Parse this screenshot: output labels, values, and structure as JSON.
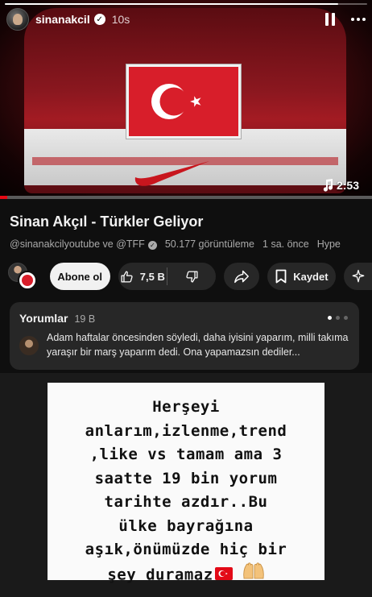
{
  "story": {
    "username": "sinanakcil",
    "time": "10s",
    "progress": 0.92
  },
  "video": {
    "duration": "2:53",
    "watched_fraction": 0.02
  },
  "youtube": {
    "title": "Sinan Akçıl - Türkler Geliyor",
    "channels": "@sinanakcilyoutube ve @TFF",
    "views": "50.177 görüntüleme",
    "uploaded": "1 sa. önce",
    "hype": "Hype",
    "subscribe_label": "Abone ol",
    "like_count": "7,5 B",
    "save_label": "Kaydet",
    "comments": {
      "title": "Yorumlar",
      "count": "19 B",
      "top_comment": "Adam haftalar öncesinden söyledi, daha iyisini yaparım, milli takıma yaraşır bir marş yaparım dedi. Ona yapamazsın dediler..."
    }
  },
  "note": {
    "lines": [
      "Herşeyi",
      "anlarım,izlenme,trend",
      ",like vs tamam ama 3",
      "saatte 19 bin yorum",
      "tarihte azdır..Bu",
      "ülke bayrağına",
      "aşık,önümüzde hiç bir",
      "şey duramaz"
    ],
    "emojis": [
      "turkey-flag-icon",
      "raised-hands-icon"
    ]
  },
  "colors": {
    "flag_red": "#d81e2a",
    "yt_background": "#0f0f0f",
    "pill_background": "#272727"
  }
}
